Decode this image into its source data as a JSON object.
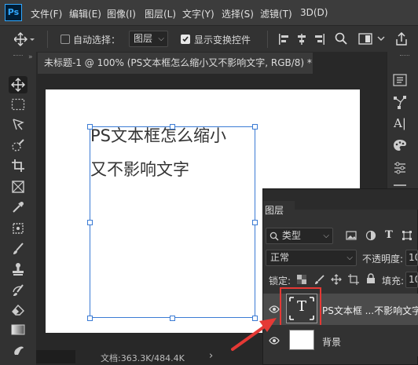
{
  "app": {
    "logo": "Ps"
  },
  "menubar": {
    "items": [
      "文件(F)",
      "编辑(E)",
      "图像(I)",
      "图层(L)",
      "文字(Y)",
      "选择(S)",
      "滤镜(T)",
      "3D(D)"
    ]
  },
  "options_bar": {
    "auto_select_label": "自动选择：",
    "auto_select_checked": false,
    "auto_select_target": "图层",
    "show_transform_label": "显示变换控件",
    "show_transform_checked": true
  },
  "document_tab": {
    "title": "未标题-1 @ 100% (PS文本框怎么缩小又不影响文字, RGB/8) *",
    "close": "×"
  },
  "canvas": {
    "text_lines": [
      "PS文本框怎么缩小",
      "又不影响文字"
    ],
    "background": "#ffffff"
  },
  "status_bar": {
    "doc_info": "文档:363.3K/484.4K",
    "arrow": "›"
  },
  "layers_panel": {
    "tab_label": "图层",
    "filter_kind": "类型",
    "blend_mode": "正常",
    "opacity_label": "不透明度:",
    "opacity_value": "10",
    "lock_label": "锁定:",
    "fill_label": "填充:",
    "fill_value": "10",
    "layers": [
      {
        "name": "PS文本框 ...不影响文字",
        "type": "text",
        "thumb_glyph": "T",
        "visible": true,
        "selected": true
      },
      {
        "name": "背景",
        "type": "background",
        "visible": true,
        "selected": false
      }
    ]
  },
  "colors": {
    "accent_blue": "#3b7bd4",
    "highlight_red": "#e53935",
    "ui_dark": "#323232"
  },
  "icons": {
    "move": "move-icon",
    "marquee": "marquee-icon",
    "lasso": "lasso-icon",
    "quick_select": "quick-select-icon",
    "crop": "crop-icon",
    "frame": "frame-icon",
    "eyedropper": "eyedropper-icon",
    "healing": "healing-brush-icon",
    "brush": "brush-icon",
    "stamp": "clone-stamp-icon",
    "history_brush": "history-brush-icon",
    "eraser": "eraser-icon",
    "gradient": "gradient-icon",
    "smudge": "smudge-icon"
  }
}
